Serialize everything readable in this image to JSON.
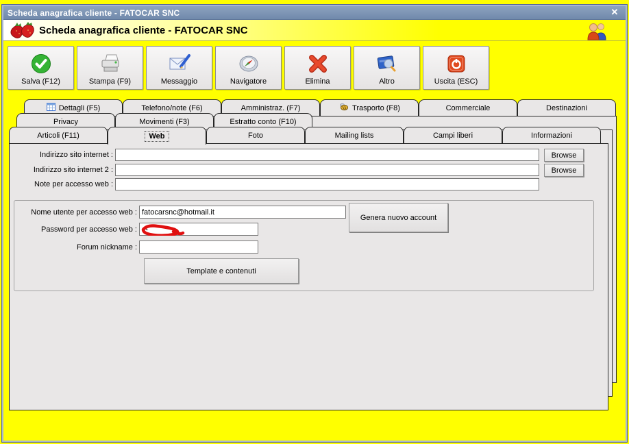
{
  "colors": {
    "app_background": "#ffff00",
    "titlebar_top": "#8da3bf",
    "titlebar_bottom": "#7089ab",
    "page_gray": "#e9e7e7",
    "redaction_red": "#e01010",
    "border_dark": "#262626"
  },
  "window": {
    "title": "Scheda anagrafica cliente - FATOCAR SNC",
    "close_glyph": "✕"
  },
  "header": {
    "title": "Scheda anagrafica cliente - FATOCAR SNC",
    "left_icon": "strawberries-icon",
    "right_icon": "users-icon"
  },
  "toolbar": {
    "buttons": [
      {
        "label": "Salva (F12)",
        "icon": "save-check-icon"
      },
      {
        "label": "Stampa (F9)",
        "icon": "printer-icon"
      },
      {
        "label": "Messaggio",
        "icon": "mail-pen-icon"
      },
      {
        "label": "Navigatore",
        "icon": "compass-icon"
      },
      {
        "label": "Elimina",
        "icon": "red-x-icon"
      },
      {
        "label": "Altro",
        "icon": "book-magnifier-icon"
      },
      {
        "label": "Uscita (ESC)",
        "icon": "power-icon"
      }
    ]
  },
  "tabs": {
    "selected": "Web",
    "row1": [
      {
        "label": "Dettagli (F5)",
        "icon": "table-icon"
      },
      {
        "label": "Telefono/note (F6)"
      },
      {
        "label": "Amministraz. (F7)"
      },
      {
        "label": "Trasporto (F8)",
        "icon": "bee-icon"
      },
      {
        "label": "Commerciale"
      },
      {
        "label": "Destinazioni"
      }
    ],
    "row2": [
      {
        "label": "Privacy"
      },
      {
        "label": "Movimenti (F3)"
      },
      {
        "label": "Estratto conto (F10)"
      }
    ],
    "row3": [
      {
        "label": "Articoli (F11)"
      },
      {
        "label": "Web"
      },
      {
        "label": "Foto"
      },
      {
        "label": "Mailing lists"
      },
      {
        "label": "Campi liberi"
      },
      {
        "label": "Informazioni"
      }
    ]
  },
  "web_tab": {
    "fields": {
      "site1_label": "Indirizzo sito internet :",
      "site1_value": "",
      "site2_label": "Indirizzo sito internet 2 :",
      "site2_value": "",
      "note_label": "Note per accesso web :",
      "note_value": "",
      "browse_label": "Browse"
    },
    "account": {
      "user_label": "Nome utente per accesso web :",
      "user_value": "fatocarsnc@hotmail.it",
      "password_label": "Password per accesso web :",
      "password_redacted": true,
      "forum_label": "Forum nickname :",
      "forum_value": "",
      "generate_button": "Genera nuovo account",
      "template_button": "Template e contenuti"
    }
  }
}
